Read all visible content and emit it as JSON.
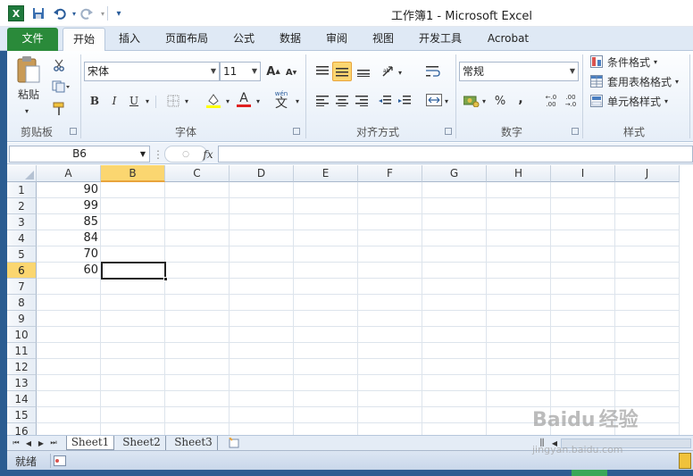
{
  "window": {
    "title": "工作簿1 - Microsoft Excel"
  },
  "quick_access": {
    "save_icon": "save-icon",
    "undo_icon": "undo-icon",
    "redo_icon": "redo-icon",
    "more": "▾"
  },
  "tabs": [
    {
      "label": "文件"
    },
    {
      "label": "开始"
    },
    {
      "label": "插入"
    },
    {
      "label": "页面布局"
    },
    {
      "label": "公式"
    },
    {
      "label": "数据"
    },
    {
      "label": "审阅"
    },
    {
      "label": "视图"
    },
    {
      "label": "开发工具"
    },
    {
      "label": "Acrobat"
    }
  ],
  "ribbon": {
    "clipboard": {
      "label": "剪贴板",
      "paste": "粘贴"
    },
    "font": {
      "label": "字体",
      "name": "宋体",
      "size": "11",
      "bold": "B",
      "italic": "I",
      "underline": "U",
      "font_color_letter": "A",
      "increase": "A",
      "decrease": "A",
      "wen": "wén"
    },
    "align": {
      "label": "对齐方式"
    },
    "number": {
      "label": "数字",
      "format": "常规",
      "percent": "%",
      "comma": ",",
      "inc_dec": ".0 .00",
      "dec_dec": ".00 .0"
    },
    "styles": {
      "label": "样式",
      "conditional": "条件格式",
      "table": "套用表格格式",
      "cell": "单元格样式"
    }
  },
  "formula_bar": {
    "name_box": "B6",
    "fx": "fx",
    "value": ""
  },
  "columns": [
    "A",
    "B",
    "C",
    "D",
    "E",
    "F",
    "G",
    "H",
    "I",
    "J"
  ],
  "rows": [
    "1",
    "2",
    "3",
    "4",
    "5",
    "6",
    "7",
    "8",
    "9",
    "10",
    "11",
    "12",
    "13",
    "14",
    "15",
    "16"
  ],
  "cells": {
    "A": [
      "90",
      "99",
      "85",
      "84",
      "70",
      "60"
    ]
  },
  "selected": {
    "column": "B",
    "row": "6"
  },
  "sheets": [
    "Sheet1",
    "Sheet2",
    "Sheet3"
  ],
  "status": {
    "ready": "就绪"
  },
  "watermark": {
    "brand": "Baidu",
    "text": "经验",
    "url": "jingyan.baidu.com"
  }
}
